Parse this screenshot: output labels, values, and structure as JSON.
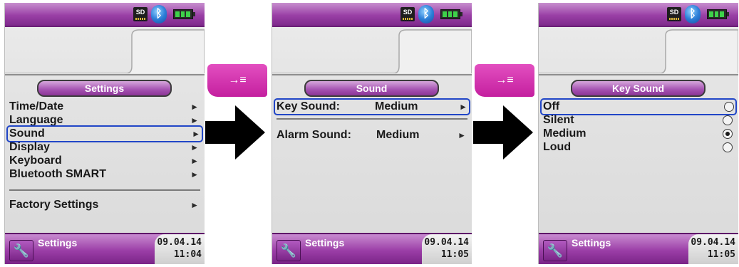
{
  "screens": [
    {
      "title": "Settings",
      "items": [
        {
          "label": "Time/Date",
          "value": "",
          "arrow": "►"
        },
        {
          "label": "Language",
          "value": "",
          "arrow": "►"
        },
        {
          "label": "Sound",
          "value": "",
          "arrow": "►"
        },
        {
          "label": "Display",
          "value": "",
          "arrow": "►"
        },
        {
          "label": "Keyboard",
          "value": "",
          "arrow": "►"
        },
        {
          "label": "Bluetooth SMART",
          "value": "",
          "arrow": "►"
        },
        {
          "label": "Factory Settings",
          "value": "",
          "arrow": "►"
        }
      ],
      "footer_label": "Settings",
      "date": "09.04.14",
      "time": "11:04"
    },
    {
      "title": "Sound",
      "items": [
        {
          "label": "Key Sound:",
          "value": "Medium",
          "arrow": "►"
        },
        {
          "label": "Alarm Sound:",
          "value": "Medium",
          "arrow": "►"
        }
      ],
      "footer_label": "Settings",
      "date": "09.04.14",
      "time": "11:05"
    },
    {
      "title": "Key Sound",
      "items": [
        {
          "label": "Off",
          "selected": false
        },
        {
          "label": "Silent",
          "selected": false
        },
        {
          "label": "Medium",
          "selected": true
        },
        {
          "label": "Loud",
          "selected": false
        }
      ],
      "footer_label": "Settings",
      "date": "09.04.14",
      "time": "11:05"
    }
  ],
  "status_icons": {
    "sd": "SD",
    "bluetooth": "bluetooth-icon",
    "battery": "battery-icon"
  },
  "shortcut_glyph": "→≡",
  "colors": {
    "accent": "#9a3fa6",
    "selection": "#2146c7",
    "shortcut": "#d02fae"
  }
}
